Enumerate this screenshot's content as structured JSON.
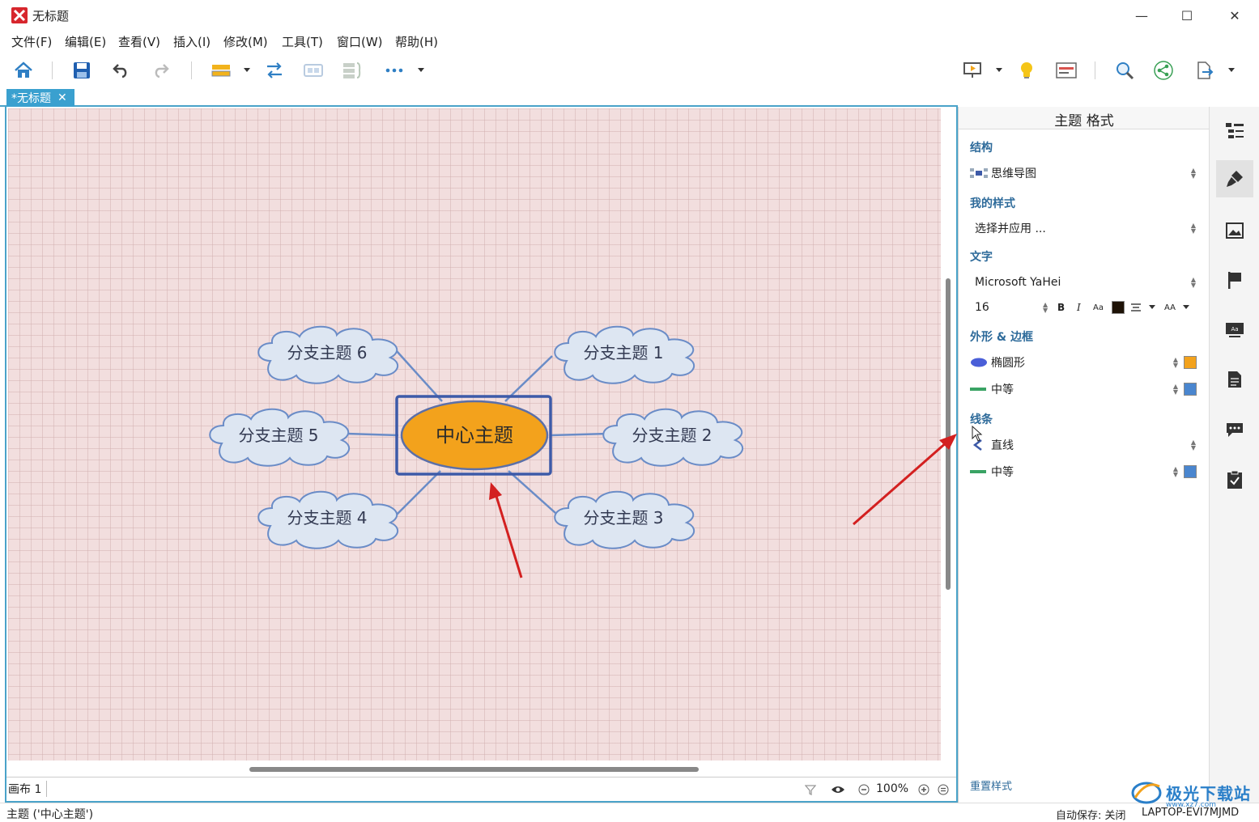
{
  "window": {
    "title": "无标题",
    "minimize": "—",
    "maximize": "☐",
    "close": "✕"
  },
  "menu": [
    "文件(F)",
    "编辑(E)",
    "查看(V)",
    "插入(I)",
    "修改(M)",
    "工具(T)",
    "窗口(W)",
    "帮助(H)"
  ],
  "tab": {
    "label": "*无标题",
    "close": "✕"
  },
  "mindmap": {
    "central": "中心主题",
    "branches": [
      "分支主题 1",
      "分支主题 2",
      "分支主题 3",
      "分支主题 4",
      "分支主题 5",
      "分支主题 6"
    ],
    "colors": {
      "central_fill": "#f3a21c",
      "central_border": "#5b6fa8",
      "selection": "#3d5aa8",
      "cloud_fill": "#dde6f2",
      "cloud_stroke": "#6a8cc7",
      "line": "#6a8cc7",
      "arrow": "#d32020"
    }
  },
  "canvas_footer": {
    "sheet": "画布 1",
    "zoom": "100%"
  },
  "panel": {
    "title": "主题 格式",
    "structure": {
      "heading": "结构",
      "value": "思维导图"
    },
    "my_style": {
      "heading": "我的样式",
      "value": "选择并应用 ..."
    },
    "text": {
      "heading": "文字",
      "font": "Microsoft YaHei",
      "size": "16",
      "bold": "B",
      "italic": "I",
      "case": "Aa",
      "caps": "AA",
      "color": "#1e1206"
    },
    "shape": {
      "heading": "外形 & 边框",
      "shape_value": "椭圆形",
      "shape_color": "#f3a21c",
      "border_value": "中等",
      "border_color": "#4a86cf"
    },
    "line": {
      "heading": "线条",
      "line_value": "直线",
      "width_value": "中等",
      "line_color": "#4a86cf"
    },
    "reset": "重置样式"
  },
  "status": {
    "left": "主题 ('中心主题')",
    "autosave": "自动保存: 关闭",
    "device": "LAPTOP-EVI7MJMD"
  },
  "watermark": {
    "text": "极光下载站",
    "sub": "www.xz7.com"
  }
}
